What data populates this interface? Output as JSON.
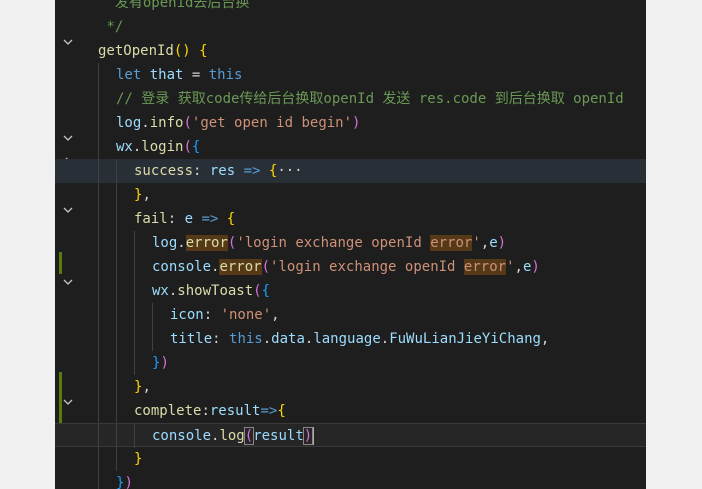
{
  "editor": {
    "lines": [
      {
        "indent": 1,
        "tokens": [
          {
            "t": "  发有openid去后台换",
            "c": "cm"
          }
        ]
      },
      {
        "indent": 1,
        "tokens": [
          {
            "t": " */",
            "c": "cm"
          }
        ]
      },
      {
        "indent": 1,
        "tokens": [
          {
            "t": "getOpenId",
            "c": "fn"
          },
          {
            "t": "() ",
            "c": "brk1"
          },
          {
            "t": "{",
            "c": "brk1"
          }
        ]
      },
      {
        "indent": 2,
        "tokens": [
          {
            "t": "let ",
            "c": "kw"
          },
          {
            "t": "that",
            "c": "vr"
          },
          {
            "t": " = ",
            "c": "lt"
          },
          {
            "t": "this",
            "c": "kw"
          }
        ]
      },
      {
        "indent": 2,
        "tokens": [
          {
            "t": "// 登录 获取code传给后台换取openId 发送 res.code 到后台换取 openId",
            "c": "cm"
          }
        ]
      },
      {
        "indent": 2,
        "tokens": [
          {
            "t": "log",
            "c": "vr"
          },
          {
            "t": ".",
            "c": "lt"
          },
          {
            "t": "info",
            "c": "fn"
          },
          {
            "t": "(",
            "c": "brk2"
          },
          {
            "t": "'get open id begin'",
            "c": "st"
          },
          {
            "t": ")",
            "c": "brk2"
          }
        ]
      },
      {
        "indent": 2,
        "tokens": [
          {
            "t": "wx",
            "c": "vr"
          },
          {
            "t": ".",
            "c": "lt"
          },
          {
            "t": "login",
            "c": "fn"
          },
          {
            "t": "(",
            "c": "brk2"
          },
          {
            "t": "{",
            "c": "brk3"
          }
        ]
      },
      {
        "indent": 3,
        "tokens": [
          {
            "t": "success",
            "c": "fn"
          },
          {
            "t": ": ",
            "c": "lt"
          },
          {
            "t": "res",
            "c": "vr"
          },
          {
            "t": " => ",
            "c": "kw"
          },
          {
            "t": "{",
            "c": "brk1"
          },
          {
            "t": "···",
            "c": "lt"
          }
        ]
      },
      {
        "indent": 3,
        "tokens": [
          {
            "t": "}",
            "c": "brk1"
          },
          {
            "t": ",",
            "c": "lt"
          }
        ]
      },
      {
        "indent": 3,
        "tokens": [
          {
            "t": "fail",
            "c": "fn"
          },
          {
            "t": ": ",
            "c": "lt"
          },
          {
            "t": "e",
            "c": "vr"
          },
          {
            "t": " => ",
            "c": "kw"
          },
          {
            "t": "{",
            "c": "brk1"
          }
        ]
      },
      {
        "indent": 4,
        "tokens": [
          {
            "t": "log",
            "c": "vr"
          },
          {
            "t": ".",
            "c": "lt"
          },
          {
            "t": "error",
            "c": "fn",
            "w": 1
          },
          {
            "t": "(",
            "c": "brk2"
          },
          {
            "t": "'login exchange openId ",
            "c": "st"
          },
          {
            "t": "error",
            "c": "st",
            "w": 1
          },
          {
            "t": "'",
            "c": "st"
          },
          {
            "t": ",",
            "c": "lt"
          },
          {
            "t": "e",
            "c": "vr"
          },
          {
            "t": ")",
            "c": "brk2"
          }
        ]
      },
      {
        "indent": 4,
        "tokens": [
          {
            "t": "console",
            "c": "vr"
          },
          {
            "t": ".",
            "c": "lt"
          },
          {
            "t": "error",
            "c": "fn",
            "w": 1
          },
          {
            "t": "(",
            "c": "brk2"
          },
          {
            "t": "'login exchange openId ",
            "c": "st"
          },
          {
            "t": "error",
            "c": "st",
            "w": 1
          },
          {
            "t": "'",
            "c": "st"
          },
          {
            "t": ",",
            "c": "lt"
          },
          {
            "t": "e",
            "c": "vr"
          },
          {
            "t": ")",
            "c": "brk2"
          }
        ]
      },
      {
        "indent": 4,
        "tokens": [
          {
            "t": "wx",
            "c": "vr"
          },
          {
            "t": ".",
            "c": "lt"
          },
          {
            "t": "showToast",
            "c": "fn"
          },
          {
            "t": "(",
            "c": "brk2"
          },
          {
            "t": "{",
            "c": "brk3"
          }
        ]
      },
      {
        "indent": 5,
        "tokens": [
          {
            "t": "icon",
            "c": "vr"
          },
          {
            "t": ": ",
            "c": "lt"
          },
          {
            "t": "'none'",
            "c": "st"
          },
          {
            "t": ",",
            "c": "lt"
          }
        ]
      },
      {
        "indent": 5,
        "tokens": [
          {
            "t": "title",
            "c": "vr"
          },
          {
            "t": ": ",
            "c": "lt"
          },
          {
            "t": "this",
            "c": "kw"
          },
          {
            "t": ".",
            "c": "lt"
          },
          {
            "t": "data",
            "c": "vr"
          },
          {
            "t": ".",
            "c": "lt"
          },
          {
            "t": "language",
            "c": "vr"
          },
          {
            "t": ".",
            "c": "lt"
          },
          {
            "t": "FuWuLianJieYiChang",
            "c": "vr"
          },
          {
            "t": ",",
            "c": "lt"
          }
        ]
      },
      {
        "indent": 4,
        "tokens": [
          {
            "t": "}",
            "c": "brk3"
          },
          {
            "t": ")",
            "c": "brk2"
          }
        ]
      },
      {
        "indent": 3,
        "tokens": [
          {
            "t": "}",
            "c": "brk1"
          },
          {
            "t": ",",
            "c": "lt"
          }
        ]
      },
      {
        "indent": 3,
        "tokens": [
          {
            "t": "complete",
            "c": "fn"
          },
          {
            "t": ":",
            "c": "lt"
          },
          {
            "t": "result",
            "c": "vr"
          },
          {
            "t": "=>",
            "c": "kw"
          },
          {
            "t": "{",
            "c": "brk1"
          }
        ]
      },
      {
        "indent": 4,
        "tokens": [
          {
            "t": "console",
            "c": "vr"
          },
          {
            "t": ".",
            "c": "lt"
          },
          {
            "t": "log",
            "c": "fn"
          },
          {
            "t": "(",
            "c": "brk2",
            "m": 1
          },
          {
            "t": "result",
            "c": "vr"
          },
          {
            "t": ")",
            "c": "brk2",
            "m": 1
          }
        ]
      },
      {
        "indent": 3,
        "tokens": [
          {
            "t": "}",
            "c": "brk1"
          }
        ]
      },
      {
        "indent": 2,
        "tokens": [
          {
            "t": "}",
            "c": "brk3"
          },
          {
            "t": ")",
            "c": "brk2"
          }
        ]
      }
    ]
  }
}
